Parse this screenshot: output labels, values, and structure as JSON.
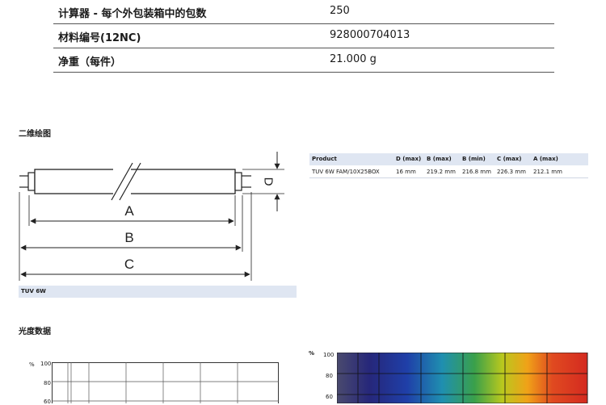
{
  "specs": [
    {
      "label": "计算器 - 每个外包装箱中的包数",
      "value": "250"
    },
    {
      "label": "材料编号(12NC)",
      "value": "928000704013"
    },
    {
      "label": "净重（每件）",
      "value": "21.000 g"
    }
  ],
  "drawing": {
    "title": "二维绘图",
    "dim_d": "D",
    "dim_a": "A",
    "dim_b": "B",
    "dim_c": "C",
    "caption": "TUV 6W"
  },
  "product_table": {
    "headers": [
      "Product",
      "D (max)",
      "B (max)",
      "B (min)",
      "C (max)",
      "A (max)"
    ],
    "rows": [
      [
        "TUV 6W FAM/10X25BOX",
        "16 mm",
        "219.2 mm",
        "216.8 mm",
        "226.3 mm",
        "212.1 mm"
      ]
    ]
  },
  "photometric": {
    "title": "光度数据",
    "left_chart": {
      "y_unit": "%",
      "y_ticks": [
        "100",
        "80",
        "60"
      ]
    },
    "right_chart": {
      "y_unit": "%",
      "y_ticks": [
        "100",
        "80",
        "60"
      ]
    }
  },
  "colors": {
    "table_header_bg": "#dfe6f2",
    "tube_fill": "#ffffff",
    "spectrum": [
      "#4a4a6e",
      "#26277a",
      "#1f3fa8",
      "#1f8fb0",
      "#3aa04a",
      "#b8c81e",
      "#f0a218",
      "#e04a20",
      "#d42a20"
    ]
  }
}
